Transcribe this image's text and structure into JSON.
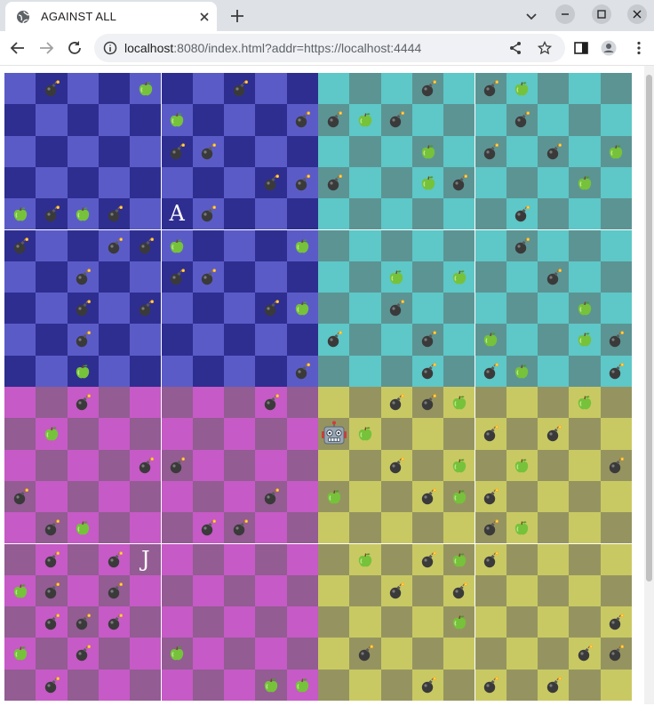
{
  "browser": {
    "tab_title": "AGAINST ALL",
    "url_host": "localhost",
    "url_rest": ":8080/index.html?addr=https://localhost:4444",
    "icons": [
      "globe-icon",
      "close-icon",
      "plus-icon",
      "chevron-down-icon",
      "minimize-icon",
      "maximize-icon",
      "close-window-icon",
      "back-arrow-icon",
      "forward-arrow-icon",
      "reload-icon",
      "info-icon",
      "share-icon",
      "star-icon",
      "side-panel-icon",
      "profile-icon",
      "kebab-menu-icon"
    ]
  },
  "board": {
    "rows": 20,
    "cols": 20,
    "quadrants": {
      "top_left": {
        "light": "#5b5bc8",
        "dark": "#2e2e91"
      },
      "top_right": {
        "light": "#5ec7c7",
        "dark": "#5c9494"
      },
      "bottom_left": {
        "light": "#c65ac6",
        "dark": "#935c93"
      },
      "bottom_right": {
        "light": "#c9c964",
        "dark": "#959460"
      }
    },
    "bombs": [
      [
        0,
        1
      ],
      [
        0,
        7
      ],
      [
        0,
        13
      ],
      [
        0,
        15
      ],
      [
        1,
        9
      ],
      [
        1,
        10
      ],
      [
        1,
        12
      ],
      [
        1,
        16
      ],
      [
        2,
        5
      ],
      [
        2,
        6
      ],
      [
        2,
        15
      ],
      [
        2,
        17
      ],
      [
        3,
        8
      ],
      [
        3,
        9
      ],
      [
        3,
        10
      ],
      [
        3,
        14
      ],
      [
        4,
        1
      ],
      [
        4,
        3
      ],
      [
        4,
        6
      ],
      [
        4,
        16
      ],
      [
        5,
        0
      ],
      [
        5,
        3
      ],
      [
        5,
        4
      ],
      [
        5,
        16
      ],
      [
        6,
        2
      ],
      [
        6,
        5
      ],
      [
        6,
        6
      ],
      [
        6,
        17
      ],
      [
        7,
        2
      ],
      [
        7,
        4
      ],
      [
        7,
        8
      ],
      [
        7,
        12
      ],
      [
        8,
        2
      ],
      [
        8,
        10
      ],
      [
        8,
        13
      ],
      [
        8,
        19
      ],
      [
        9,
        9
      ],
      [
        9,
        13
      ],
      [
        9,
        15
      ],
      [
        9,
        19
      ],
      [
        10,
        2
      ],
      [
        10,
        8
      ],
      [
        10,
        12
      ],
      [
        10,
        13
      ],
      [
        11,
        15
      ],
      [
        11,
        17
      ],
      [
        12,
        4
      ],
      [
        12,
        5
      ],
      [
        12,
        12
      ],
      [
        12,
        19
      ],
      [
        13,
        0
      ],
      [
        13,
        8
      ],
      [
        13,
        13
      ],
      [
        13,
        15
      ],
      [
        14,
        1
      ],
      [
        14,
        6
      ],
      [
        14,
        7
      ],
      [
        14,
        15
      ],
      [
        15,
        1
      ],
      [
        15,
        3
      ],
      [
        15,
        13
      ],
      [
        15,
        15
      ],
      [
        16,
        1
      ],
      [
        16,
        3
      ],
      [
        16,
        12
      ],
      [
        16,
        14
      ],
      [
        17,
        1
      ],
      [
        17,
        2
      ],
      [
        17,
        3
      ],
      [
        17,
        19
      ],
      [
        18,
        2
      ],
      [
        18,
        11
      ],
      [
        18,
        18
      ],
      [
        18,
        19
      ],
      [
        19,
        1
      ],
      [
        19,
        13
      ],
      [
        19,
        15
      ],
      [
        19,
        17
      ]
    ],
    "apples": [
      [
        0,
        4
      ],
      [
        0,
        16
      ],
      [
        1,
        5
      ],
      [
        1,
        11
      ],
      [
        2,
        13
      ],
      [
        2,
        19
      ],
      [
        3,
        13
      ],
      [
        3,
        18
      ],
      [
        4,
        0
      ],
      [
        4,
        2
      ],
      [
        5,
        5
      ],
      [
        5,
        9
      ],
      [
        6,
        12
      ],
      [
        6,
        14
      ],
      [
        7,
        9
      ],
      [
        7,
        18
      ],
      [
        8,
        15
      ],
      [
        8,
        18
      ],
      [
        9,
        2
      ],
      [
        9,
        16
      ],
      [
        10,
        14
      ],
      [
        10,
        18
      ],
      [
        11,
        1
      ],
      [
        11,
        11
      ],
      [
        12,
        14
      ],
      [
        12,
        16
      ],
      [
        13,
        10
      ],
      [
        13,
        14
      ],
      [
        14,
        2
      ],
      [
        14,
        16
      ],
      [
        15,
        11
      ],
      [
        15,
        14
      ],
      [
        16,
        0
      ],
      [
        17,
        14
      ],
      [
        18,
        0
      ],
      [
        18,
        5
      ],
      [
        19,
        8
      ],
      [
        19,
        9
      ]
    ],
    "players": [
      {
        "label": "A",
        "row": 4,
        "col": 5
      },
      {
        "label": "J",
        "row": 15,
        "col": 4
      }
    ],
    "robot": {
      "row": 11,
      "col": 10
    }
  }
}
